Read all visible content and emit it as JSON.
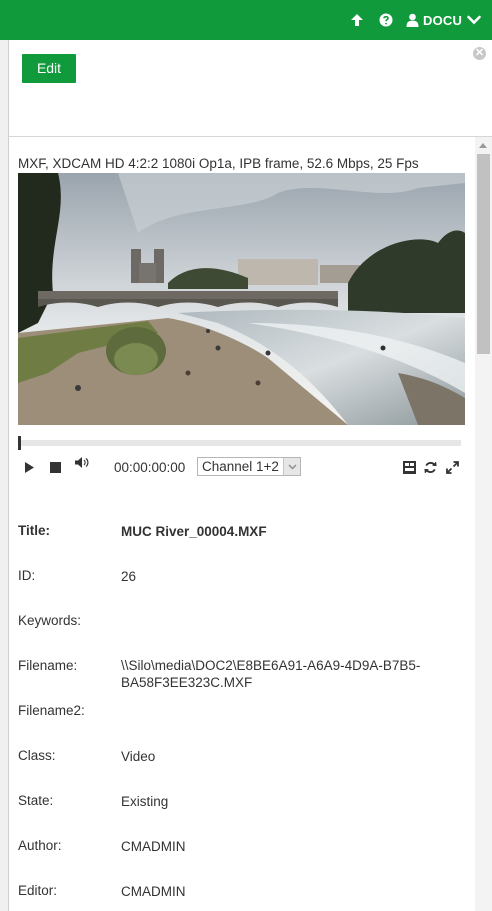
{
  "topbar": {
    "user": "DOCU",
    "icons": [
      "arrow-up-icon",
      "help-icon",
      "user-icon",
      "chevron-down-icon"
    ],
    "color": "#109a3c"
  },
  "panel": {
    "edit_label": "Edit",
    "close_icon": "close-icon"
  },
  "media": {
    "format": "MXF, XDCAM HD 4:2:2 1080i Op1a, IPB frame, 52.6 Mbps, 25 Fps",
    "timecode": "00:00:00:00",
    "channel": "Channel 1+2",
    "progress": 0
  },
  "meta": [
    {
      "label": "Title:",
      "value": "MUC River_00004.MXF"
    },
    {
      "label": "ID:",
      "value": "26"
    },
    {
      "label": "Keywords:",
      "value": ""
    },
    {
      "label": "Filename:",
      "value": "\\\\Silo\\media\\DOC2\\E8BE6A91-A6A9-4D9A-B7B5-BA58F3EE323C.MXF"
    },
    {
      "label": "Filename2:",
      "value": ""
    },
    {
      "label": "Class:",
      "value": "Video"
    },
    {
      "label": "State:",
      "value": "Existing"
    },
    {
      "label": "Author:",
      "value": "CMADMIN"
    },
    {
      "label": "Editor:",
      "value": "CMADMIN"
    }
  ]
}
